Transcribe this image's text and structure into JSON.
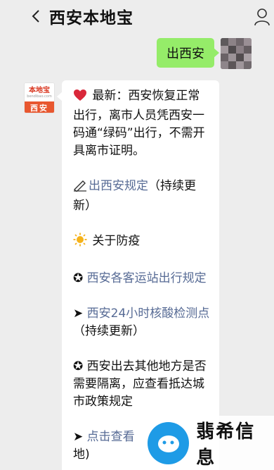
{
  "header": {
    "title": "西安本地宝"
  },
  "outgoing_message": {
    "text": "出西安"
  },
  "incoming_message": {
    "p1_text": "最新：西安恢复正常出行，离市人员凭西安一码通“绿码”出行，不需开具离市证明。",
    "p2_link": "出西安规定",
    "p2_suffix": "（持续更新）",
    "p3_text": "关于防疫",
    "p4_prefix": "✪ ",
    "p4_link": "西安各客运站出行规定",
    "p5_prefix": "➤ ",
    "p5_link": "西安24小时核酸检测点",
    "p5_suffix": "（持续更新）",
    "p6_text": "✪ 西安出去其他地方是否需要隔离，应查看抵达城市政策规定",
    "p7_prefix": "➤ ",
    "p7_link": "点击查看",
    "p7_suffix": "地)"
  },
  "avatar_logo": {
    "brand": "本地宝",
    "sub": "bendibao.com",
    "city": "西安"
  },
  "watermark": {
    "text": "翡希信息"
  },
  "colors": {
    "background": "#ededed",
    "bubble_out": "#95ec69",
    "bubble_in": "#ffffff",
    "link": "#576b95",
    "logo_red": "#e8572f",
    "watermark_blue": "#1e9be6"
  }
}
